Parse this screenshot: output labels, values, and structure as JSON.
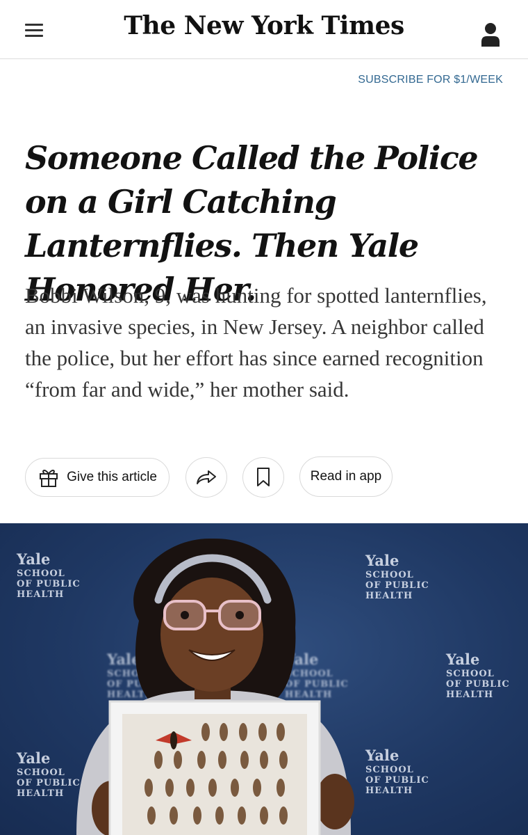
{
  "header": {
    "masthead": "The New York Times",
    "menu_icon": "hamburger-menu-icon",
    "account_icon": "user-account-icon",
    "subscribe_label": "SUBSCRIBE FOR $1/WEEK"
  },
  "article": {
    "headline": "Someone Called the Police on a Girl Catching Lanternflies. Then Yale Honored Her.",
    "summary": "Bobbi Wilson, 9, was hunting for spotted lanternflies, an invasive species, in New Jersey. A neighbor called the police, but her effort has since earned recognition “from far and wide,” her mother said."
  },
  "actions": {
    "give_label": "Give this article",
    "give_icon": "gift-icon",
    "share_icon": "share-arrow-icon",
    "save_icon": "bookmark-icon",
    "app_label": "Read in app"
  },
  "photo": {
    "backdrop_logo": {
      "line1": "Yale",
      "line2": "SCHOOL",
      "line3": "OF PUBLIC",
      "line4": "HEALTH"
    },
    "colors": {
      "backdrop": "#1f3863",
      "dress": "#c9c9cf",
      "headband": "#b8bcc9"
    }
  },
  "colors": {
    "link": "#326891",
    "text": "#121212",
    "summary": "#363636",
    "border": "#d9d9d9"
  }
}
